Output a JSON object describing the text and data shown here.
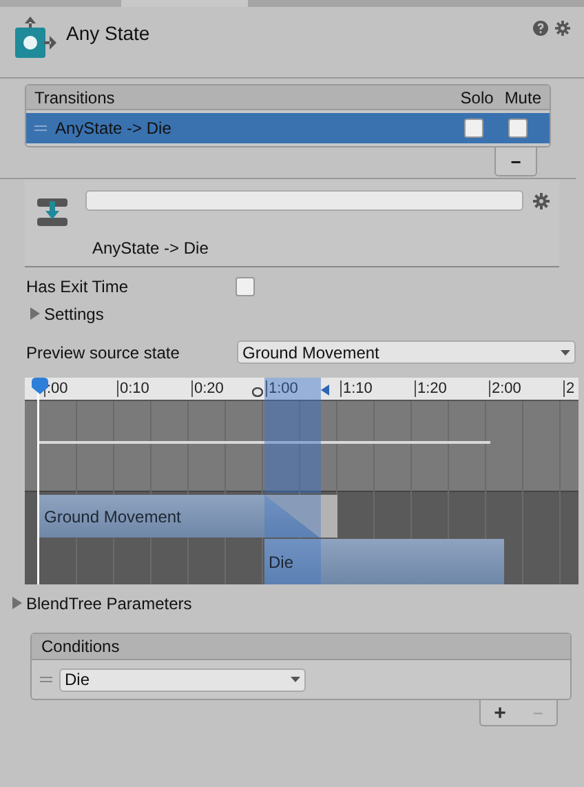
{
  "header": {
    "title": "Any State"
  },
  "transitions": {
    "columns": [
      "Transitions",
      "Solo",
      "Mute"
    ],
    "rows": [
      {
        "name": "AnyState -> Die",
        "selected": true,
        "solo": false,
        "mute": false
      }
    ],
    "remove_button": "−"
  },
  "transition": {
    "label": "AnyState -> Die"
  },
  "has_exit_time": {
    "label": "Has Exit Time",
    "checked": false
  },
  "settings": {
    "label": "Settings",
    "expanded": false
  },
  "preview_source_state": {
    "label": "Preview source state",
    "value": "Ground Movement"
  },
  "timeline": {
    "ticks": [
      ":00",
      "0:10",
      "0:20",
      "1:00",
      "1:10",
      "1:20",
      "2:00",
      "2"
    ],
    "clips": [
      {
        "name": "Ground Movement"
      },
      {
        "name": "Die"
      }
    ]
  },
  "blendtree_parameters": {
    "label": "BlendTree Parameters",
    "expanded": false
  },
  "conditions": {
    "title": "Conditions",
    "rows": [
      {
        "parameter": "Die"
      }
    ],
    "add_button": "+",
    "remove_button": "−"
  }
}
